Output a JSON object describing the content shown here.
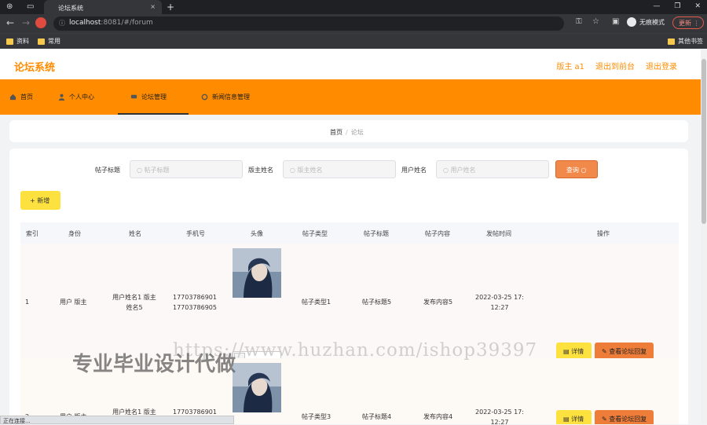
{
  "browser": {
    "tab_title": "论坛系统",
    "tab_close": "×",
    "new_tab": "+",
    "win_ctrl_min": "—",
    "win_ctrl_max": "❐",
    "win_ctrl_close": "✕",
    "url_host": "localhost",
    "url_rest": ":8081/#/forum",
    "incognito_label": "无痕模式",
    "update_label": "更新",
    "bookmarks": [
      "资料",
      "常用"
    ],
    "other_bookmarks": "其他书签",
    "status_text": "正在连接..."
  },
  "header": {
    "logo": "论坛系统",
    "user": "版主 a1",
    "back_to_front": "退出到前台",
    "logout": "退出登录"
  },
  "menu": {
    "items": [
      "首页",
      "个人中心",
      "论坛管理",
      "新闻信息管理"
    ],
    "active": "论坛管理"
  },
  "breadcrumb": {
    "home": "首页",
    "sep": "/",
    "current": "论坛"
  },
  "filters": {
    "title_label": "帖子标题",
    "title_placeholder": "帖子标题",
    "mod_label": "版主姓名",
    "mod_placeholder": "版主姓名",
    "user_label": "用户姓名",
    "user_placeholder": "用户姓名",
    "search_label": "查询"
  },
  "add_label": "新增",
  "table": {
    "columns": [
      "索引",
      "身份",
      "姓名",
      "手机号",
      "头像",
      "帖子类型",
      "帖子标题",
      "帖子内容",
      "发帖时间",
      "操作"
    ],
    "rows": [
      {
        "index": "1",
        "role": "用户 版主",
        "name_line1": "用户姓名1 版主",
        "name_line2": "姓名5",
        "phone1": "17703786901",
        "phone2": "17703786905",
        "type": "帖子类型1",
        "title": "帖子标题5",
        "content": "发布内容5",
        "time_line1": "2022-03-25 17:",
        "time_line2": "12:27",
        "detail": "详情",
        "reply": "查看论坛回复"
      },
      {
        "index": "2",
        "role": "用户 版主",
        "name_line1": "用户姓名1 版主",
        "name_line2": "",
        "phone1": "17703786901",
        "phone2": "",
        "type": "帖子类型3",
        "title": "帖子标题4",
        "content": "发布内容4",
        "time_line1": "2022-03-25 17:",
        "time_line2": "12:27",
        "detail": "详情",
        "reply": "查看论坛回复"
      }
    ]
  },
  "watermark": {
    "url": "https://www.huzhan.com/ishop39397",
    "text": "专业毕业设计代做"
  },
  "colors": {
    "accent": "#ff8c00",
    "yellow_btn": "#fce13f",
    "orange_btn": "#ee7d3a"
  }
}
